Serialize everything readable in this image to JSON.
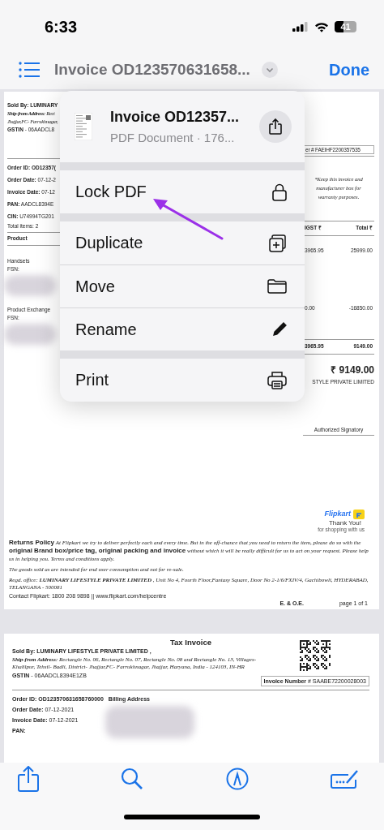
{
  "status_bar": {
    "time": "6:33",
    "battery": "41"
  },
  "nav_bar": {
    "title": "Invoice OD123570631658...",
    "done": "Done"
  },
  "page_1": {
    "sold_by": "Sold By: LUMINARY",
    "address_lines": [
      "**Ship-from Address:** Rect",
      "Jhajjar,FC- Farrukhnagar,"
    ],
    "gstin": "**GSTIN** - 06AADCL8",
    "order_id": "Order ID: OD12357(",
    "fields": [
      "**Order Date:** 07-12-2",
      "**Invoice Date:** 07-12",
      "**PAN:** AADCL8394E",
      "**CIN:** U74994TG201"
    ],
    "total_items": "Total items: 2",
    "invoice_number": "er # FAEIHF2200357535",
    "note": "*Keep this invoice and manufacturer box for warranty purposes.",
    "columns": [
      "Product",
      "IGST ₹",
      "Total ₹"
    ],
    "rows": [
      {
        "product": "Handsets",
        "fsn": "FSN:",
        "igst": "3965.95",
        "total": "25999.00"
      },
      {
        "product": "Product Exchange",
        "fsn": "FSN:",
        "igst": "0.00",
        "total": "-16850.00"
      }
    ],
    "totals": {
      "igst": "3965.95",
      "total": "9149.00"
    },
    "grand_total": "₹ 9149.00",
    "company": "STYLE PRIVATE LIMITED",
    "signatory": "Authorized Signatory",
    "logo": "Flipkart",
    "thanks": "Thank You!",
    "thanks_sub": "for shopping with us",
    "returns_policy": "**Returns Policy** *At Flipkart we try to deliver perfectly each and every time. But in the off-chance that you need to return the item, please do so with the* **original Brand box/price tag, original packing and invoice** *without which it will be really difficult for us to act on your request. Please help us in helping you. Terms and conditions apply.*",
    "disclaimer": "The goods sold as are intended for end user consumption and not for re-sale.",
    "regd_office": "Regd. office: **LUMINARY LIFESTYLE PRIVATE LIMITED** , Unit No 4, Fourth Floor,Fantasy Square, Door No 2-1/6/FXIV/4, Gachibowli, HYDERABAD, TELANGANA - 500081",
    "contact": "Contact Flipkart: 1800 208 9898 || www.flipkart.com/helpcentre",
    "eoe": "E. & O.E.",
    "page_label": "page 1 of 1"
  },
  "page_2": {
    "title": "Tax Invoice",
    "sold_by": "Sold By: LUMINARY LIFESTYLE PRIVATE LIMITED ,",
    "address": "**Ship-from Address:** Rectangle No. 06, Rectangle No. 07, Rectangle No. 08 and Rectangle No. 13, Villages- Khalilpur, Tehsil- Badli, District- Jhajjar,FC- Farrukhnagar, Jhajjar, Haryana, India - 124103, IN-HR",
    "gstin": "**GSTIN** - 06AADCL8394E1ZB",
    "invoice_number": "**Invoice Number** # SAABE72200028003",
    "order_id": "Order ID: OD123570631658760000",
    "billing": "Billing Address",
    "fields": [
      "**Order Date:** 07-12-2021",
      "**Invoice Date:** 07-12-2021",
      "**PAN:**"
    ]
  },
  "menu": {
    "title": "Invoice OD12357...",
    "subtitle": "PDF Document · 176...",
    "groups": [
      [
        {
          "label": "Lock PDF"
        }
      ],
      [
        {
          "label": "Duplicate"
        },
        {
          "label": "Move"
        },
        {
          "label": "Rename"
        }
      ],
      [
        {
          "label": "Print"
        }
      ]
    ]
  }
}
